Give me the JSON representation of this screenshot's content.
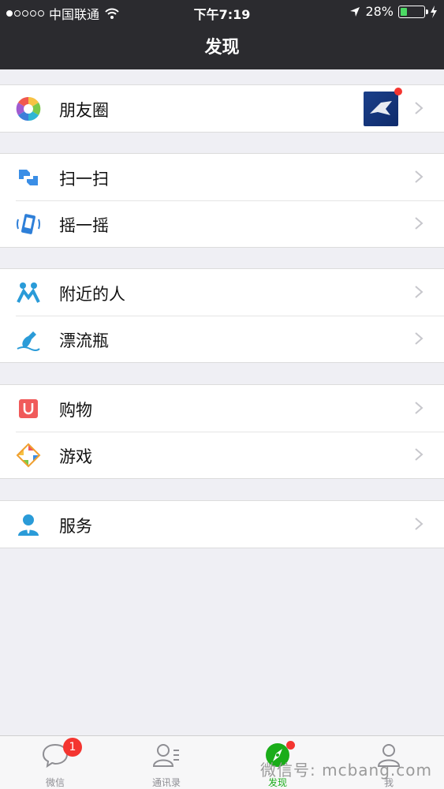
{
  "status": {
    "carrier": "中国联通",
    "time": "下午7:19",
    "battery": "28%",
    "battery_level": 0.28
  },
  "header": {
    "title": "发现"
  },
  "groups": [
    {
      "items": [
        {
          "label": "朋友圈",
          "icon": "moments-icon"
        }
      ]
    },
    {
      "items": [
        {
          "label": "扫一扫",
          "icon": "scan-icon"
        },
        {
          "label": "摇一摇",
          "icon": "shake-icon"
        }
      ]
    },
    {
      "items": [
        {
          "label": "附近的人",
          "icon": "people-nearby-icon"
        },
        {
          "label": "漂流瓶",
          "icon": "drift-bottle-icon"
        }
      ]
    },
    {
      "items": [
        {
          "label": "购物",
          "icon": "shopping-icon"
        },
        {
          "label": "游戏",
          "icon": "games-icon"
        }
      ]
    },
    {
      "items": [
        {
          "label": "服务",
          "icon": "services-icon"
        }
      ]
    }
  ],
  "tabbar": {
    "tabs": [
      {
        "label": "微信",
        "icon": "chat-bubble-icon",
        "badge": "1"
      },
      {
        "label": "通讯录",
        "icon": "contacts-icon"
      },
      {
        "label": "发现",
        "icon": "compass-icon",
        "active": true
      },
      {
        "label": "我",
        "icon": "person-icon"
      }
    ]
  },
  "watermark": "微信号: mcbang.com",
  "colors": {
    "accent": "#1aad19",
    "badge": "#f43530",
    "navbar": "#2b2b2f",
    "background": "#efeff4"
  }
}
